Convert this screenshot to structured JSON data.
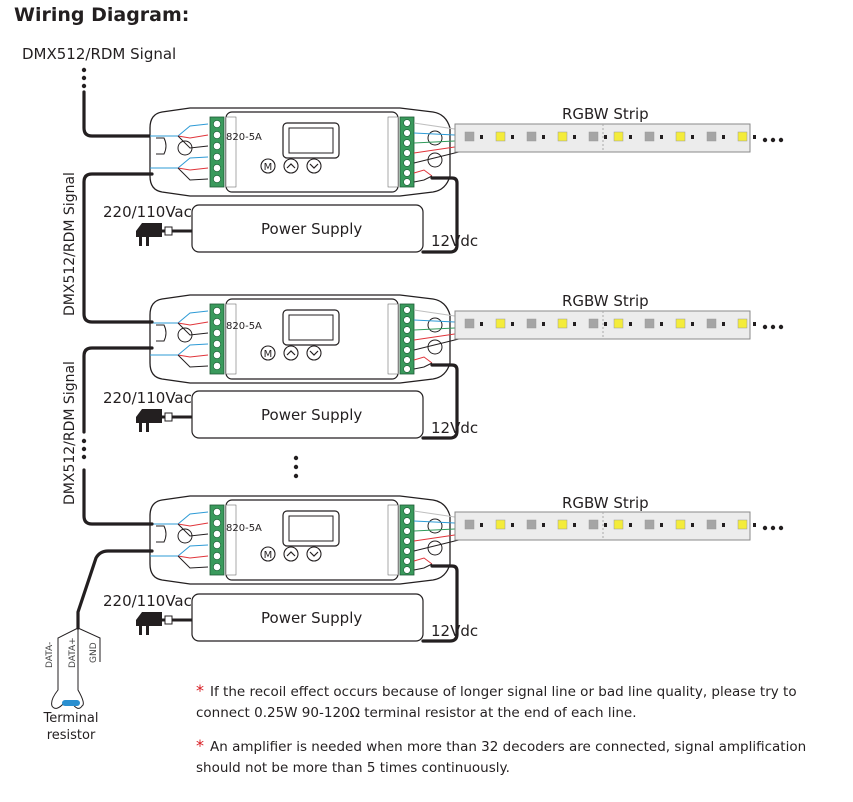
{
  "title": "Wiring Diagram:",
  "signal_input_label": "DMX512/RDM Signal",
  "chain_signal_labels": [
    "DMX512/RDM Signal",
    "DMX512/RDM Signal"
  ],
  "units": [
    {
      "decoder": {
        "model": "820-5A",
        "buttons": [
          "M",
          "up",
          "down"
        ]
      },
      "strip_label": "RGBW Strip",
      "power_supply": {
        "label": "Power Supply",
        "input": "220/110Vac",
        "output": "12Vdc"
      }
    },
    {
      "decoder": {
        "model": "820-5A",
        "buttons": [
          "M",
          "up",
          "down"
        ]
      },
      "strip_label": "RGBW Strip",
      "power_supply": {
        "label": "Power Supply",
        "input": "220/110Vac",
        "output": "12Vdc"
      }
    },
    {
      "decoder": {
        "model": "820-5A",
        "buttons": [
          "M",
          "up",
          "down"
        ]
      },
      "strip_label": "RGBW Strip",
      "power_supply": {
        "label": "Power Supply",
        "input": "220/110Vac",
        "output": "12Vdc"
      }
    }
  ],
  "terminal": {
    "wires": [
      "DATA-",
      "DATA+",
      "GND"
    ],
    "label_line1": "Terminal",
    "label_line2": "resistor"
  },
  "notes": [
    {
      "marker": "*",
      "text": "If the recoil effect occurs because of longer signal line or bad line quality, please try to connect 0.25W 90-120Ω terminal resistor at the end of each line."
    },
    {
      "marker": "*",
      "text": "An amplifier is needed when more than 32 decoders are connected, signal amplification should not be more than 5 times continuously."
    }
  ],
  "colors": {
    "wire_black": "#231f20",
    "wire_blue": "#2e9bd6",
    "wire_red": "#e0343a",
    "wire_green": "#2f9a5a",
    "wire_white": "#bfbfbf",
    "terminal_green": "#3a9a5c",
    "led_yellow": "#f4ec3a",
    "strip_bg": "#ececec",
    "asterisk": "#d7191f",
    "resistor_blue": "#2a8fd0"
  }
}
